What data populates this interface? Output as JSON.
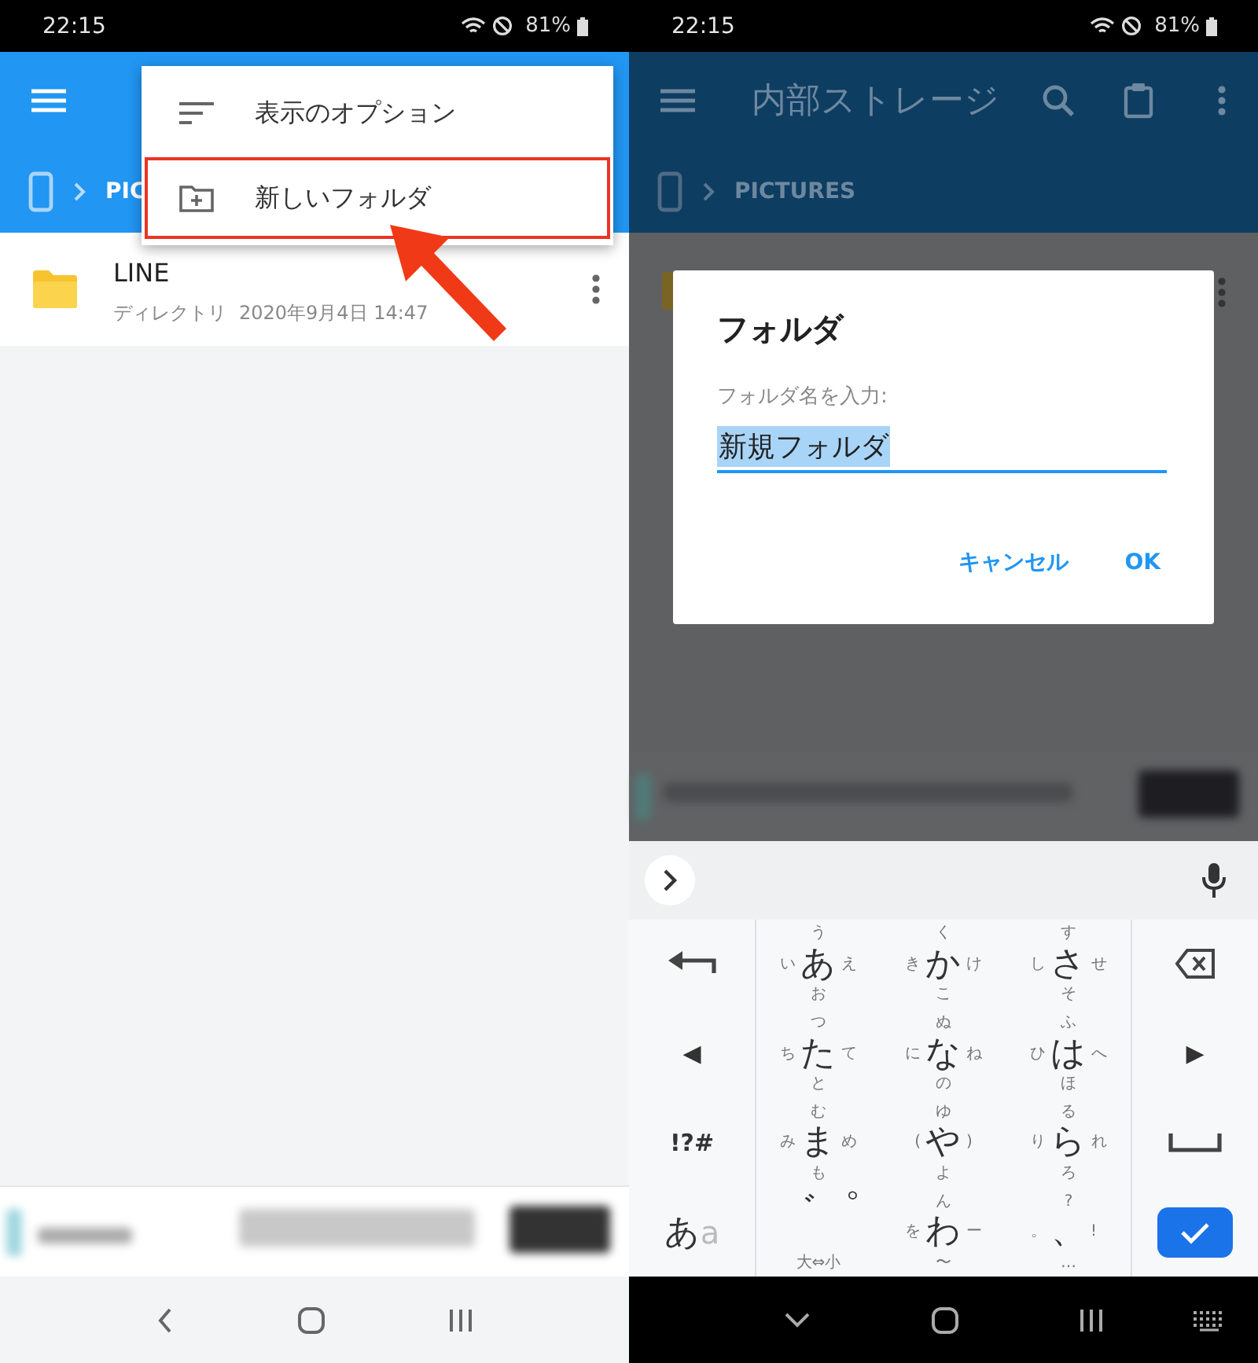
{
  "left_screen": {
    "status_bar": {
      "time": "22:15",
      "battery": "81%"
    },
    "breadcrumb": "PIC",
    "files": [
      {
        "name": "LINE",
        "type": "ディレクトリ",
        "date": "2020年9月4日 14:47"
      }
    ],
    "menu": [
      {
        "kind": "sort",
        "label": "表示のオプション",
        "highlighted": false
      },
      {
        "kind": "new-folder",
        "label": "新しいフォルダ",
        "highlighted": true
      }
    ],
    "callout_arrow": true
  },
  "right_screen": {
    "status_bar": {
      "time": "22:15",
      "battery": "81%"
    },
    "title": "内部ストレージ",
    "breadcrumb": "PICTURES",
    "dialog": {
      "title": "フォルダ",
      "label": "フォルダ名を入力:",
      "value": "新規フォルダ",
      "value_selected": true,
      "buttons": [
        "キャンセル",
        "OK"
      ]
    },
    "keyboard": {
      "left_keys": [
        {
          "kind": "undo"
        },
        {
          "kind": "arrow",
          "label": "◀"
        },
        {
          "kind": "symbols",
          "label": "!?#"
        },
        {
          "kind": "mode",
          "label": "あ",
          "sub": "a"
        }
      ],
      "right_keys": [
        {
          "kind": "backspace"
        },
        {
          "kind": "arrow",
          "label": "▶"
        },
        {
          "kind": "space"
        },
        {
          "kind": "enter"
        }
      ],
      "kana_keys": [
        {
          "main": "あ",
          "up": "う",
          "left": "い",
          "right": "え",
          "down": "お"
        },
        {
          "main": "か",
          "up": "く",
          "left": "き",
          "right": "け",
          "down": "こ"
        },
        {
          "main": "さ",
          "up": "す",
          "left": "し",
          "right": "せ",
          "down": "そ"
        },
        {
          "main": "た",
          "up": "つ",
          "left": "ち",
          "right": "て",
          "down": "と"
        },
        {
          "main": "な",
          "up": "ぬ",
          "left": "に",
          "right": "ね",
          "down": "の"
        },
        {
          "main": "は",
          "up": "ふ",
          "left": "ひ",
          "right": "へ",
          "down": "ほ"
        },
        {
          "main": "ま",
          "up": "む",
          "left": "み",
          "right": "め",
          "down": "も"
        },
        {
          "main": "や",
          "up": "ゆ",
          "left": "(",
          "right": ")",
          "down": "よ"
        },
        {
          "main": "ら",
          "up": "る",
          "left": "り",
          "right": "れ",
          "down": "ろ"
        },
        {
          "main": "゛゜",
          "down": "大⇔小"
        },
        {
          "main": "わ",
          "up": "ん",
          "left": "を",
          "right": "ー",
          "down": "〜"
        },
        {
          "main": "、",
          "up": "?",
          "left": "。",
          "right": "!",
          "down": "…"
        }
      ]
    }
  }
}
